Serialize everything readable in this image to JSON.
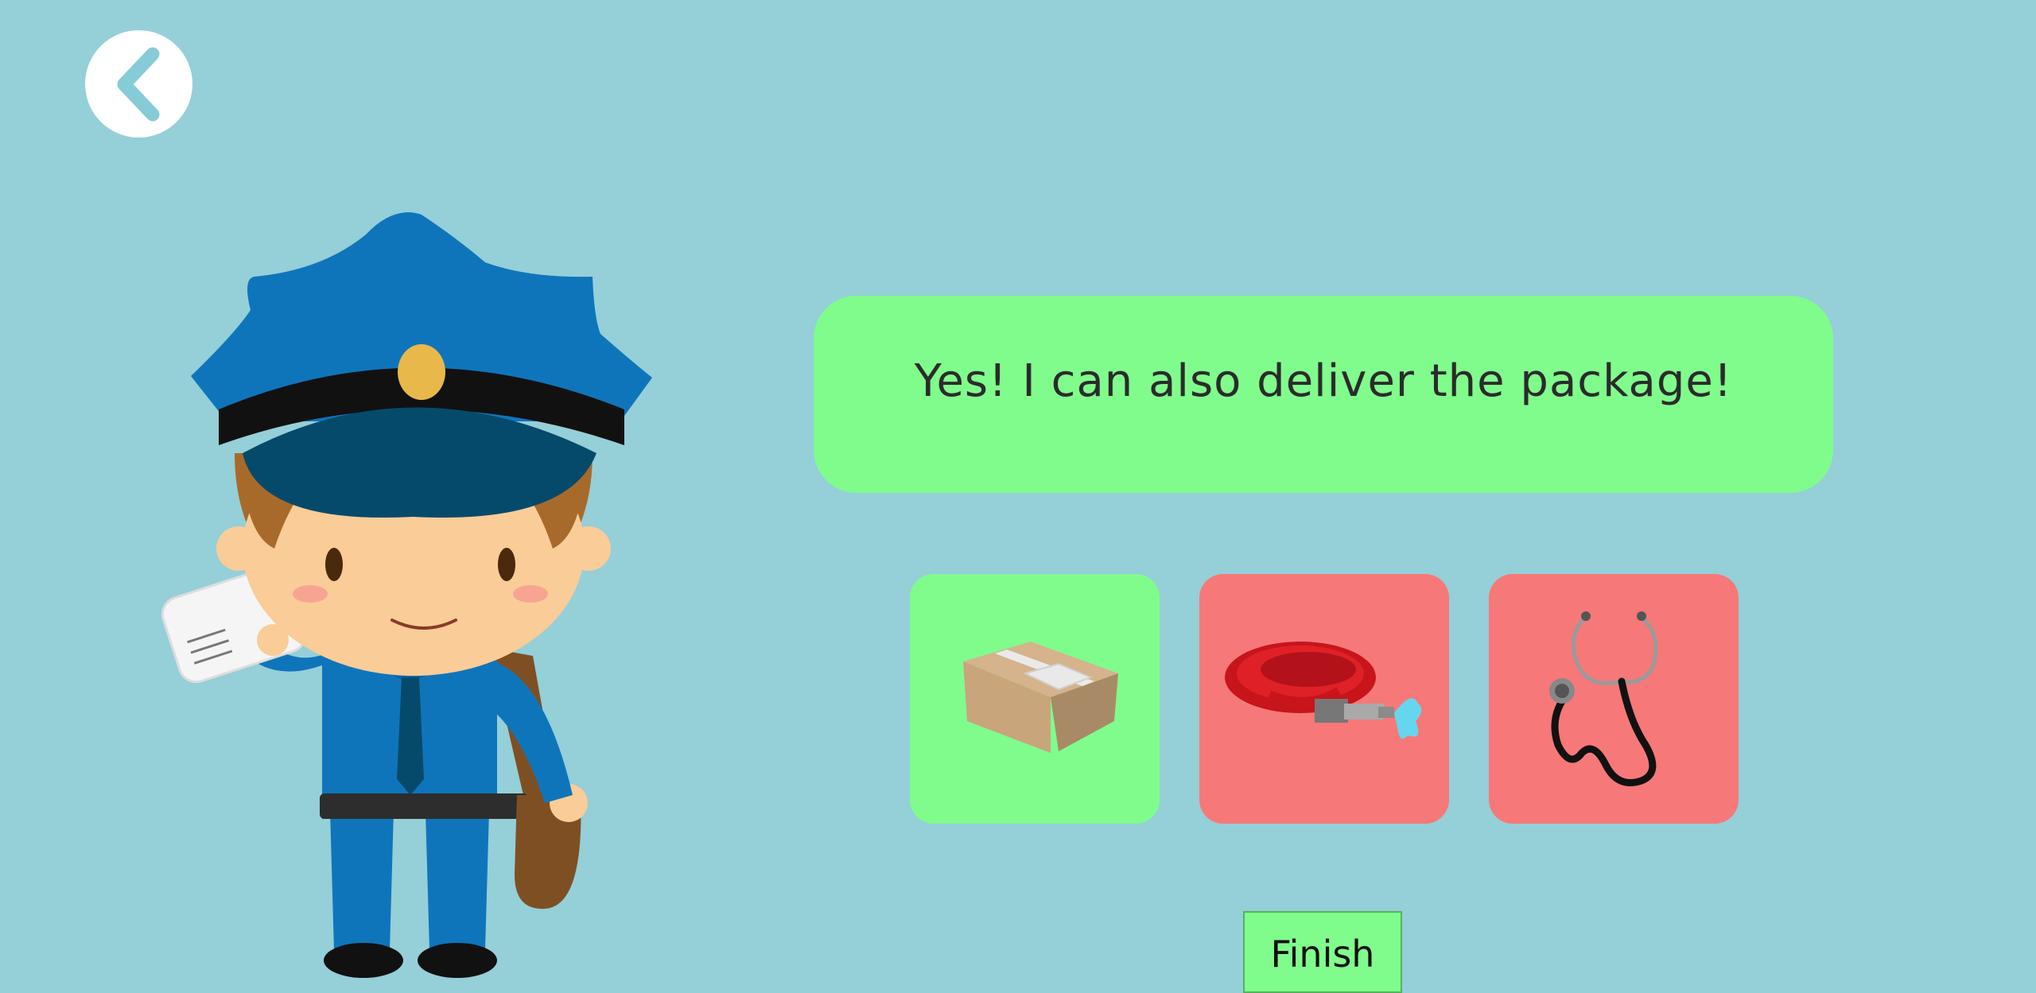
{
  "app": {
    "background_color": "#95cfd8"
  },
  "back_button": {
    "icon": "chevron-left-icon",
    "icon_color": "#86cbd7"
  },
  "character": {
    "name": "postman",
    "uniform_color": "#0f75bb"
  },
  "speech_bubble": {
    "text": "Yes! I can also deliver the package!",
    "color": "#80fc8c"
  },
  "choices": [
    {
      "item": "package",
      "state": "correct",
      "color": "#80fc8c"
    },
    {
      "item": "fire-hose",
      "state": "wrong",
      "color": "#f77878"
    },
    {
      "item": "stethoscope",
      "state": "wrong",
      "color": "#f77878"
    }
  ],
  "finish_button": {
    "label": "Finish",
    "color": "#80fc8c"
  }
}
